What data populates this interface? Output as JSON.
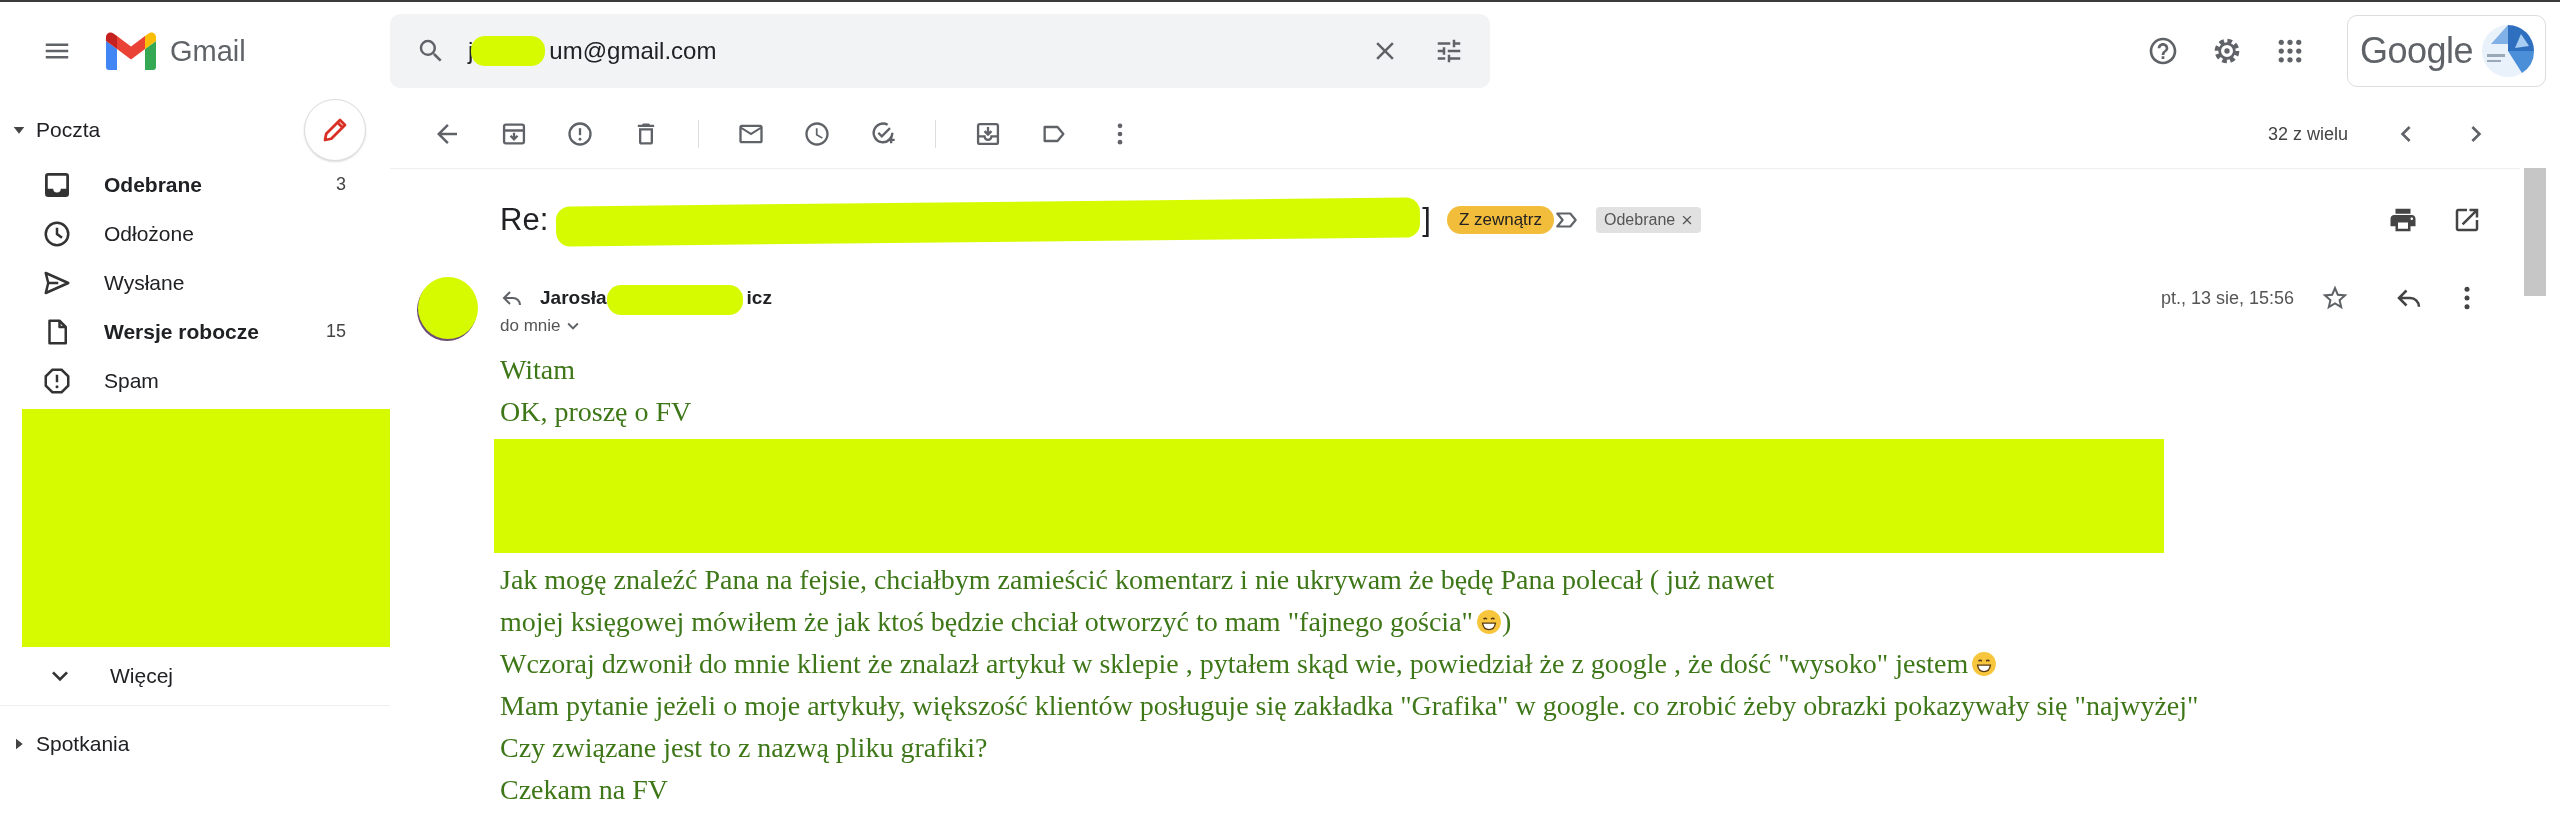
{
  "header": {
    "app_name": "Gmail",
    "search": {
      "value_start": "j",
      "value_end": "um@gmail.com"
    },
    "account_label": "Google"
  },
  "sidebar": {
    "section": "Poczta",
    "items": [
      {
        "label": "Odebrane",
        "count": "3",
        "unread": true,
        "kind": "inbox"
      },
      {
        "label": "Odłożone",
        "unread": false,
        "kind": "snoozed"
      },
      {
        "label": "Wysłane",
        "unread": false,
        "kind": "sent"
      },
      {
        "label": "Wersje robocze",
        "count": "15",
        "unread": true,
        "kind": "drafts"
      },
      {
        "label": "Spam",
        "unread": false,
        "kind": "spam"
      }
    ],
    "more": "Więcej",
    "section_2": "Spotkania"
  },
  "toolbar": {
    "counter": "32 z wielu"
  },
  "message": {
    "subject_start": "Re:",
    "subject_end": "]",
    "labels": [
      {
        "text": "Z zewnątrz",
        "kind": "tag"
      },
      {
        "text": "Odebrane",
        "kind": "removable"
      }
    ],
    "sender_start": "Jarosła",
    "sender_end": "icz",
    "recipient": "do mnie",
    "date": "pt., 13 sie, 15:56",
    "body": [
      {
        "kind": "text",
        "text": "Witam"
      },
      {
        "kind": "text",
        "text": "OK, proszę o FV"
      },
      {
        "kind": "redacted"
      },
      {
        "kind": "text",
        "text": "Jak mogę znaleźć Pana na fejsie, chciałbym zamieścić komentarz i nie ukrywam że będę Pana polecał ( już nawet"
      },
      {
        "kind": "text",
        "text": "mojej księgowej mówiłem że jak ktoś będzie chciał otworzyć to mam \"fajnego gościa\"",
        "emoji": true,
        "tail": ")"
      },
      {
        "kind": "text",
        "text": "Wczoraj dzwonił do mnie klient że znalazł artykuł w sklepie , pytałem skąd wie, powiedział że z google , że dość \"wysoko\" jestem",
        "emoji": true
      },
      {
        "kind": "text",
        "text": "Mam pytanie jeżeli o moje artykuły, większość klientów posługuje się zakładka \"Grafika\" w google. co zrobić żeby obrazki pokazywały się \"najwyżej\""
      },
      {
        "kind": "text",
        "text": "Czy związane jest to z nazwą pliku grafiki?"
      },
      {
        "kind": "text",
        "text": "Czekam  na FV"
      }
    ]
  }
}
